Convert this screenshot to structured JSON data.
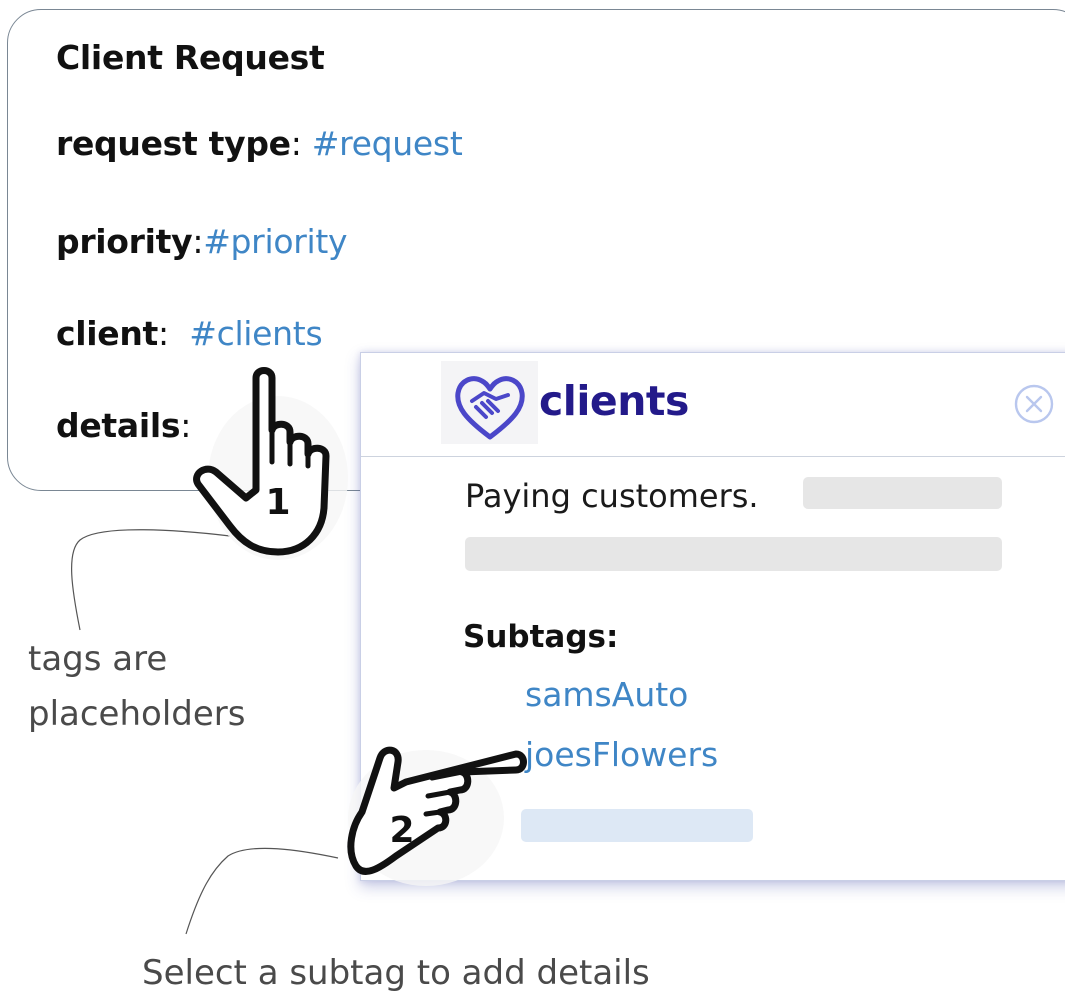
{
  "card": {
    "title": "Client Request",
    "fields": [
      {
        "label": "request type",
        "sep": ": ",
        "tag": "#request"
      },
      {
        "label": "priority",
        "sep": ":",
        "tag": "#priority"
      },
      {
        "label": "client",
        "sep": ":  ",
        "tag": "#clients"
      },
      {
        "label": "details",
        "sep": ":",
        "tag": ""
      }
    ]
  },
  "popup": {
    "title": "clients",
    "description": "Paying customers.",
    "subtags_label": "Subtags:",
    "subtags": [
      "samsAuto",
      "joesFlowers"
    ]
  },
  "annotations": {
    "placeholders": "tags are placeholders",
    "select_subtag": "Select a subtag to add details"
  },
  "steps": {
    "step1": "1",
    "step2": "2"
  },
  "colors": {
    "tag_link": "#3f86c6",
    "popup_title": "#231a8a",
    "logo": "#4b47c9"
  },
  "icons": {
    "logo": "handshake-heart-icon",
    "close": "close-circle-icon",
    "pointer": "pointing-hand-icon"
  }
}
